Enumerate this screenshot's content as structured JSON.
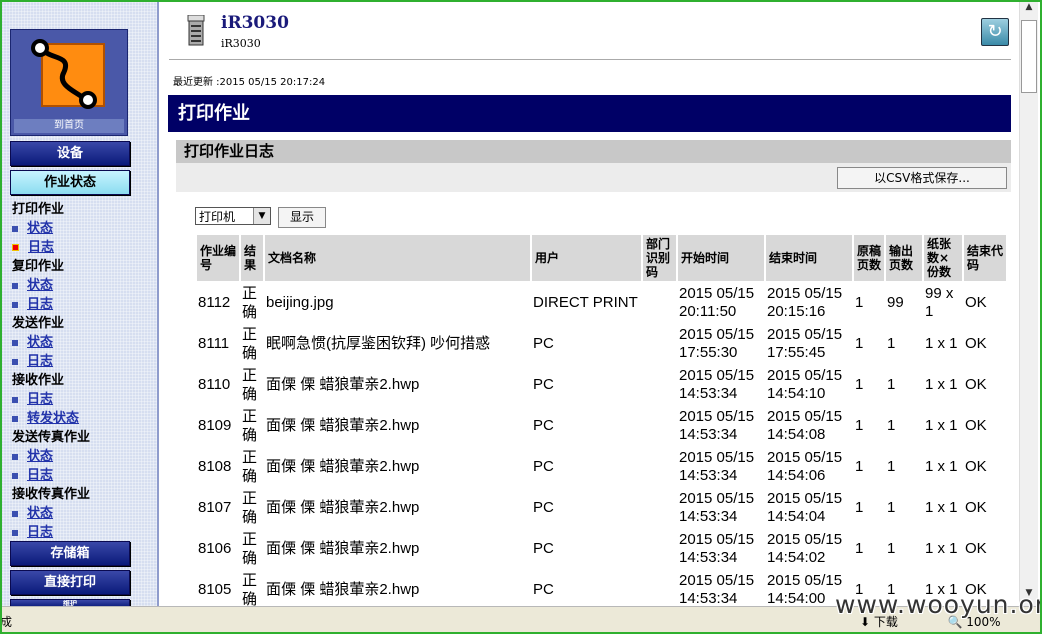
{
  "sidebar": {
    "home_caption": "到首页",
    "device_button": "设备",
    "job_status_button": "作业状态",
    "sections": [
      {
        "title": "打印作业",
        "links": [
          "状态",
          "日志"
        ]
      },
      {
        "title": "复印作业",
        "links": [
          "状态",
          "日志"
        ]
      },
      {
        "title": "发送作业",
        "links": [
          "状态",
          "日志"
        ]
      },
      {
        "title": "接收作业",
        "links": [
          "日志",
          "转发状态"
        ]
      },
      {
        "title": "发送传真作业",
        "links": [
          "状态",
          "日志"
        ]
      },
      {
        "title": "接收传真作业",
        "links": [
          "状态",
          "日志"
        ]
      }
    ],
    "storage_button": "存储箱",
    "direct_print_button": "直接打印",
    "partial_button": "维护"
  },
  "header": {
    "device_name": "iR3030",
    "device_sub": "iR3030",
    "last_updated": "最近更新 :2015 05/15 20:17:24"
  },
  "page": {
    "title": "打印作业",
    "log_title": "打印作业日志",
    "csv_button": "以CSV格式保存...",
    "filter_value": "打印机",
    "show_button": "显示"
  },
  "table": {
    "headers": [
      "作业编号",
      "结果",
      "文档名称",
      "用户",
      "部门识别码",
      "开始时间",
      "结束时间",
      "原稿页数",
      "输出页数",
      "纸张数×份数",
      "结束代码"
    ],
    "rows": [
      {
        "id": "8112",
        "result": "正确",
        "doc": "beijing.jpg",
        "user": "DIRECT PRINT",
        "dept": "",
        "start": "2015 05/15 20:11:50",
        "end": "2015 05/15 20:15:16",
        "orig": "1",
        "out": "99",
        "sheets": "99 x 1",
        "code": "OK"
      },
      {
        "id": "8111",
        "result": "正确",
        "doc": "眠啊急惯(抗厚鉴困钦拜) 吵何措惑",
        "user": "PC",
        "dept": "",
        "start": "2015 05/15 17:55:30",
        "end": "2015 05/15 17:55:45",
        "orig": "1",
        "out": "1",
        "sheets": "1 x 1",
        "code": "OK"
      },
      {
        "id": "8110",
        "result": "正确",
        "doc": "面傈 傈 蜡狼葷亲2.hwp",
        "user": "PC",
        "dept": "",
        "start": "2015 05/15 14:53:34",
        "end": "2015 05/15 14:54:10",
        "orig": "1",
        "out": "1",
        "sheets": "1 x 1",
        "code": "OK"
      },
      {
        "id": "8109",
        "result": "正确",
        "doc": "面傈 傈 蜡狼葷亲2.hwp",
        "user": "PC",
        "dept": "",
        "start": "2015 05/15 14:53:34",
        "end": "2015 05/15 14:54:08",
        "orig": "1",
        "out": "1",
        "sheets": "1 x 1",
        "code": "OK"
      },
      {
        "id": "8108",
        "result": "正确",
        "doc": "面傈 傈 蜡狼葷亲2.hwp",
        "user": "PC",
        "dept": "",
        "start": "2015 05/15 14:53:34",
        "end": "2015 05/15 14:54:06",
        "orig": "1",
        "out": "1",
        "sheets": "1 x 1",
        "code": "OK"
      },
      {
        "id": "8107",
        "result": "正确",
        "doc": "面傈 傈 蜡狼葷亲2.hwp",
        "user": "PC",
        "dept": "",
        "start": "2015 05/15 14:53:34",
        "end": "2015 05/15 14:54:04",
        "orig": "1",
        "out": "1",
        "sheets": "1 x 1",
        "code": "OK"
      },
      {
        "id": "8106",
        "result": "正确",
        "doc": "面傈 傈 蜡狼葷亲2.hwp",
        "user": "PC",
        "dept": "",
        "start": "2015 05/15 14:53:34",
        "end": "2015 05/15 14:54:02",
        "orig": "1",
        "out": "1",
        "sheets": "1 x 1",
        "code": "OK"
      },
      {
        "id": "8105",
        "result": "正确",
        "doc": "面傈 傈 蜡狼葷亲2.hwp",
        "user": "PC",
        "dept": "",
        "start": "2015 05/15 14:53:34",
        "end": "2015 05/15 14:54:00",
        "orig": "1",
        "out": "1",
        "sheets": "1 x 1",
        "code": "OK"
      }
    ]
  },
  "statusbar": {
    "left": "成",
    "download": "下载",
    "zoom": "100%"
  },
  "watermark": "www.wooyun.org",
  "colors": {
    "title_bar": "#000066",
    "link": "#2233aa",
    "nav_button": "#0a1a7a"
  }
}
